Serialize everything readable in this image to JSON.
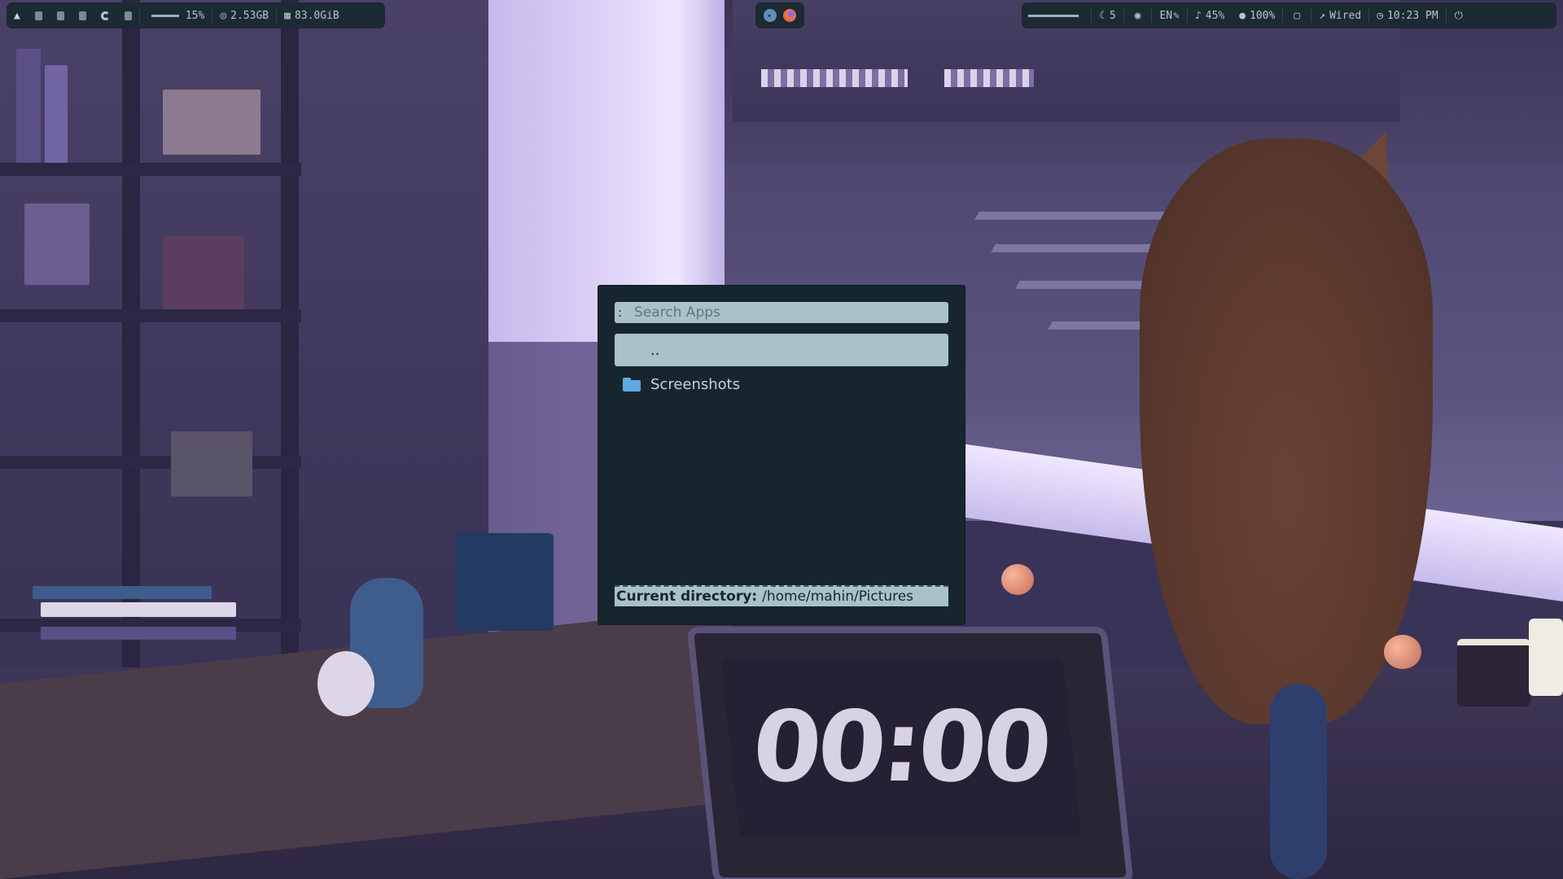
{
  "topbar": {
    "left": {
      "arch_icon": "arch-logo-icon",
      "workspaces": [
        "ws-1",
        "ws-2",
        "ws-3",
        "ws-4",
        "ws-5"
      ],
      "cpu": "15%",
      "memory": "2.53GB",
      "disk": "83.0GiB"
    },
    "center": {
      "tray_apps": [
        "vscode-icon",
        "firefox-icon"
      ]
    },
    "right": {
      "moon_count": "5",
      "language": "EN",
      "volume": "45%",
      "mic": "100%",
      "network": "Wired",
      "clock": "10:23 PM"
    }
  },
  "launcher": {
    "search_prompt": ":",
    "search_placeholder": "Search Apps",
    "entries": [
      {
        "label": "..",
        "selected": true,
        "icon": ""
      },
      {
        "label": "Screenshots",
        "selected": false,
        "icon": "folder-icon"
      }
    ],
    "status_label": "Current directory:",
    "status_value": "/home/mahin/Pictures"
  },
  "wallpaper": {
    "laptop_clock": "00:00"
  },
  "colors": {
    "bar_bg": "#1b2a33",
    "launcher_bg": "#17262e",
    "accent": "#a9c1c9",
    "power": "#e0586a"
  }
}
